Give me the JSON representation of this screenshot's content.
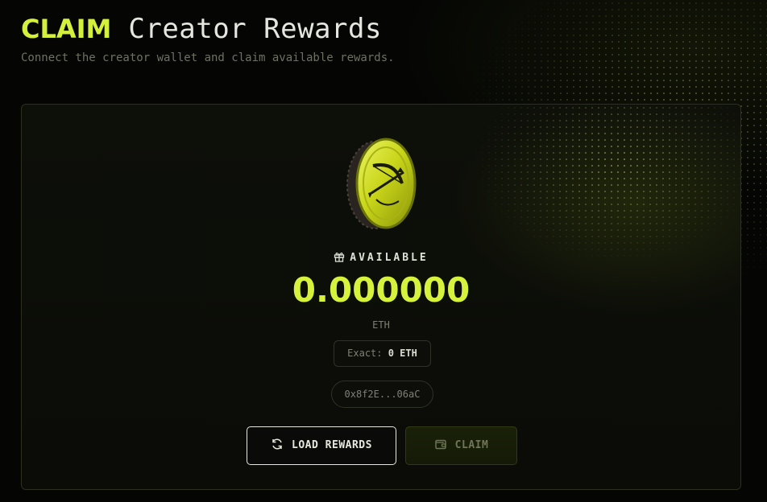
{
  "header": {
    "title_accent": "CLAIM",
    "title_rest": "Creator Rewards",
    "subtitle": "Connect the creator wallet and claim available rewards."
  },
  "rewards": {
    "available_label": "AVAILABLE",
    "amount": "0.000000",
    "unit": "ETH",
    "exact_label": "Exact:",
    "exact_value": "0 ETH",
    "wallet_address": "0x8f2E...06aC"
  },
  "actions": {
    "load_label": "LOAD REWARDS",
    "claim_label": "CLAIM"
  },
  "icons": {
    "coin": "bow-arrow-coin-icon",
    "available": "gift-icon",
    "load": "refresh-icon",
    "claim": "wallet-icon"
  },
  "colors": {
    "accent": "#d4f03c",
    "background": "#050604",
    "card_border": "#2c301c"
  }
}
